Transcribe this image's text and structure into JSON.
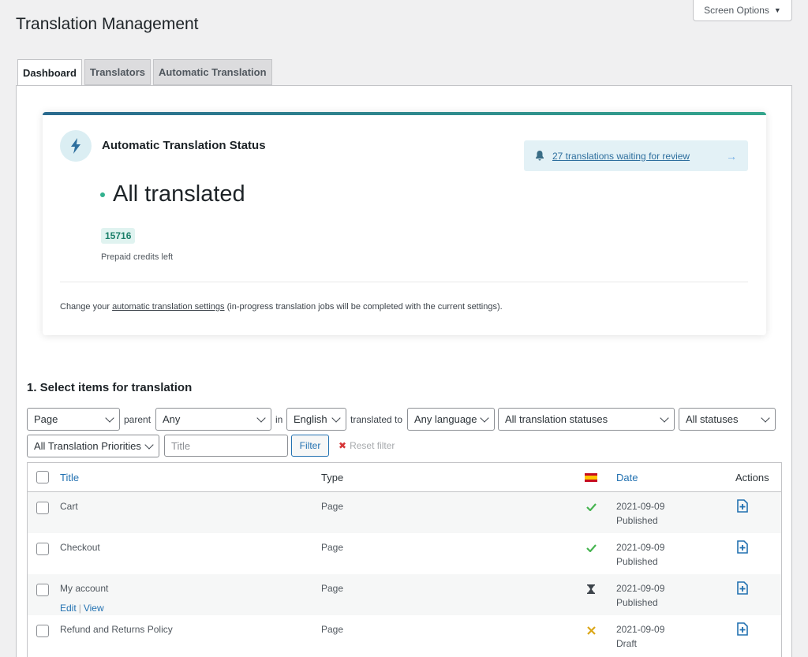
{
  "page_title": "Translation Management",
  "screen_options": "Screen Options",
  "tabs": [
    "Dashboard",
    "Translators",
    "Automatic Translation"
  ],
  "ate": {
    "title": "Automatic Translation Status",
    "review_link": "27 translations waiting for review",
    "status": "All translated",
    "credits": "15716",
    "credits_label": "Prepaid credits left",
    "footer_prefix": "Change your",
    "footer_link": "automatic translation settings",
    "footer_suffix": "(in-progress translation jobs will be completed with the current settings).",
    "accent_colors": [
      "#2a6a8e",
      "#33a58c"
    ]
  },
  "section_title": "1. Select items for translation",
  "filters": {
    "type": "Page",
    "parent_label": "parent",
    "parent": "Any",
    "in_label": "in",
    "language": "English",
    "translated_to_label": "translated to",
    "target_language": "Any language",
    "translation_status": "All translation statuses",
    "status": "All statuses",
    "priority": "All Translation Priorities",
    "title_placeholder": "Title",
    "filter_button": "Filter",
    "reset_filter": "Reset filter"
  },
  "table": {
    "headers": {
      "title": "Title",
      "type": "Type",
      "date": "Date",
      "actions": "Actions"
    },
    "flag_icon": "spain-flag-icon",
    "row_actions": {
      "edit": "Edit",
      "view": "View"
    },
    "rows": [
      {
        "title": "Cart",
        "type": "Page",
        "status_icon": "check-icon",
        "date": "2021-09-09",
        "post_status": "Published"
      },
      {
        "title": "Checkout",
        "type": "Page",
        "status_icon": "check-icon",
        "date": "2021-09-09",
        "post_status": "Published"
      },
      {
        "title": "My account",
        "type": "Page",
        "status_icon": "hourglass-icon",
        "date": "2021-09-09",
        "post_status": "Published"
      },
      {
        "title": "Refund and Returns Policy",
        "type": "Page",
        "status_icon": "cross-icon",
        "date": "2021-09-09",
        "post_status": "Draft"
      }
    ]
  }
}
